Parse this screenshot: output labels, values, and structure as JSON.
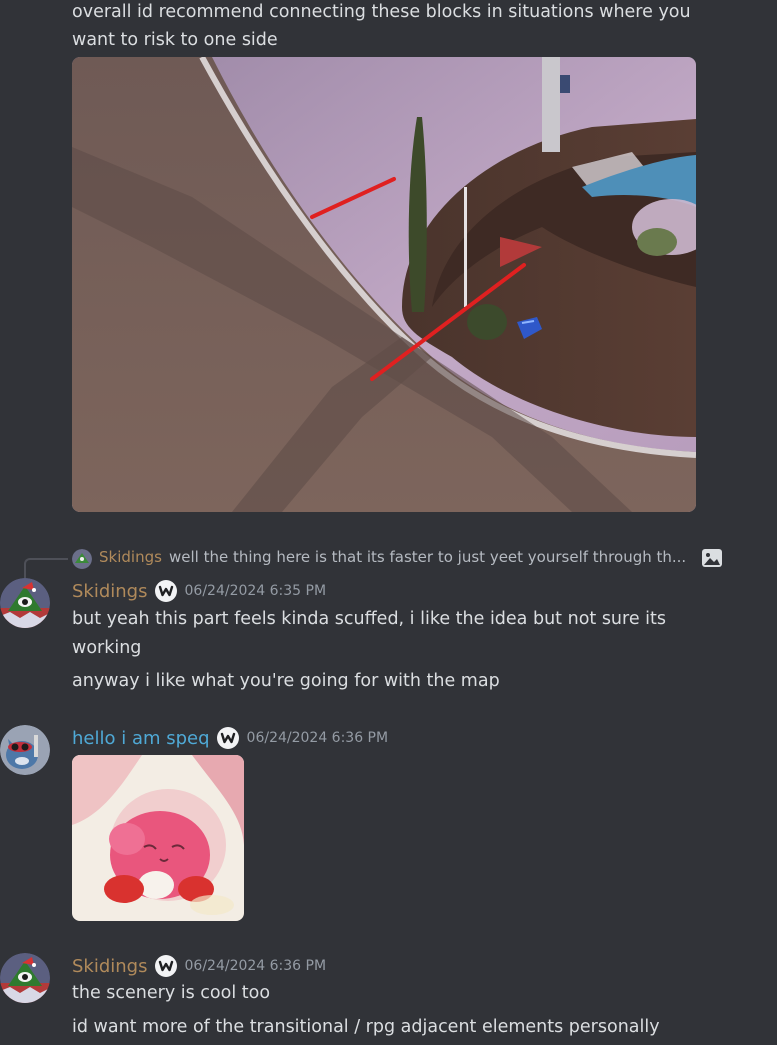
{
  "colors": {
    "background": "#313338",
    "text": "#dbdee1",
    "muted": "#949ba4",
    "skidings_name": "#b08a5b",
    "speq_name": "#4fa9d6"
  },
  "messages": {
    "top": {
      "lines": [
        "overall id recommend connecting these blocks in situations where you",
        "want to risk to one side"
      ],
      "attachment_icon": "game-screenshot-image"
    },
    "skidings_1": {
      "reply": {
        "author": "Skidings",
        "text": "well the thing here is that its faster to just yeet yourself through th...",
        "icon": "image-icon"
      },
      "author": "Skidings",
      "badge_icon": "server-tag-badge-icon",
      "timestamp": "06/24/2024 6:35 PM",
      "lines": [
        "but yeah this part feels kinda scuffed, i like the idea but not sure its",
        "working",
        "anyway i like what you're going for with the map"
      ]
    },
    "speq": {
      "author": "hello i am speq",
      "badge_icon": "server-tag-badge-icon",
      "timestamp": "06/24/2024 6:36 PM",
      "attachment_icon": "kirby-image"
    },
    "skidings_2": {
      "author": "Skidings",
      "badge_icon": "server-tag-badge-icon",
      "timestamp": "06/24/2024 6:36 PM",
      "lines": [
        "the scenery is cool too",
        "id want more of the transitional / rpg adjacent elements personally"
      ]
    }
  }
}
